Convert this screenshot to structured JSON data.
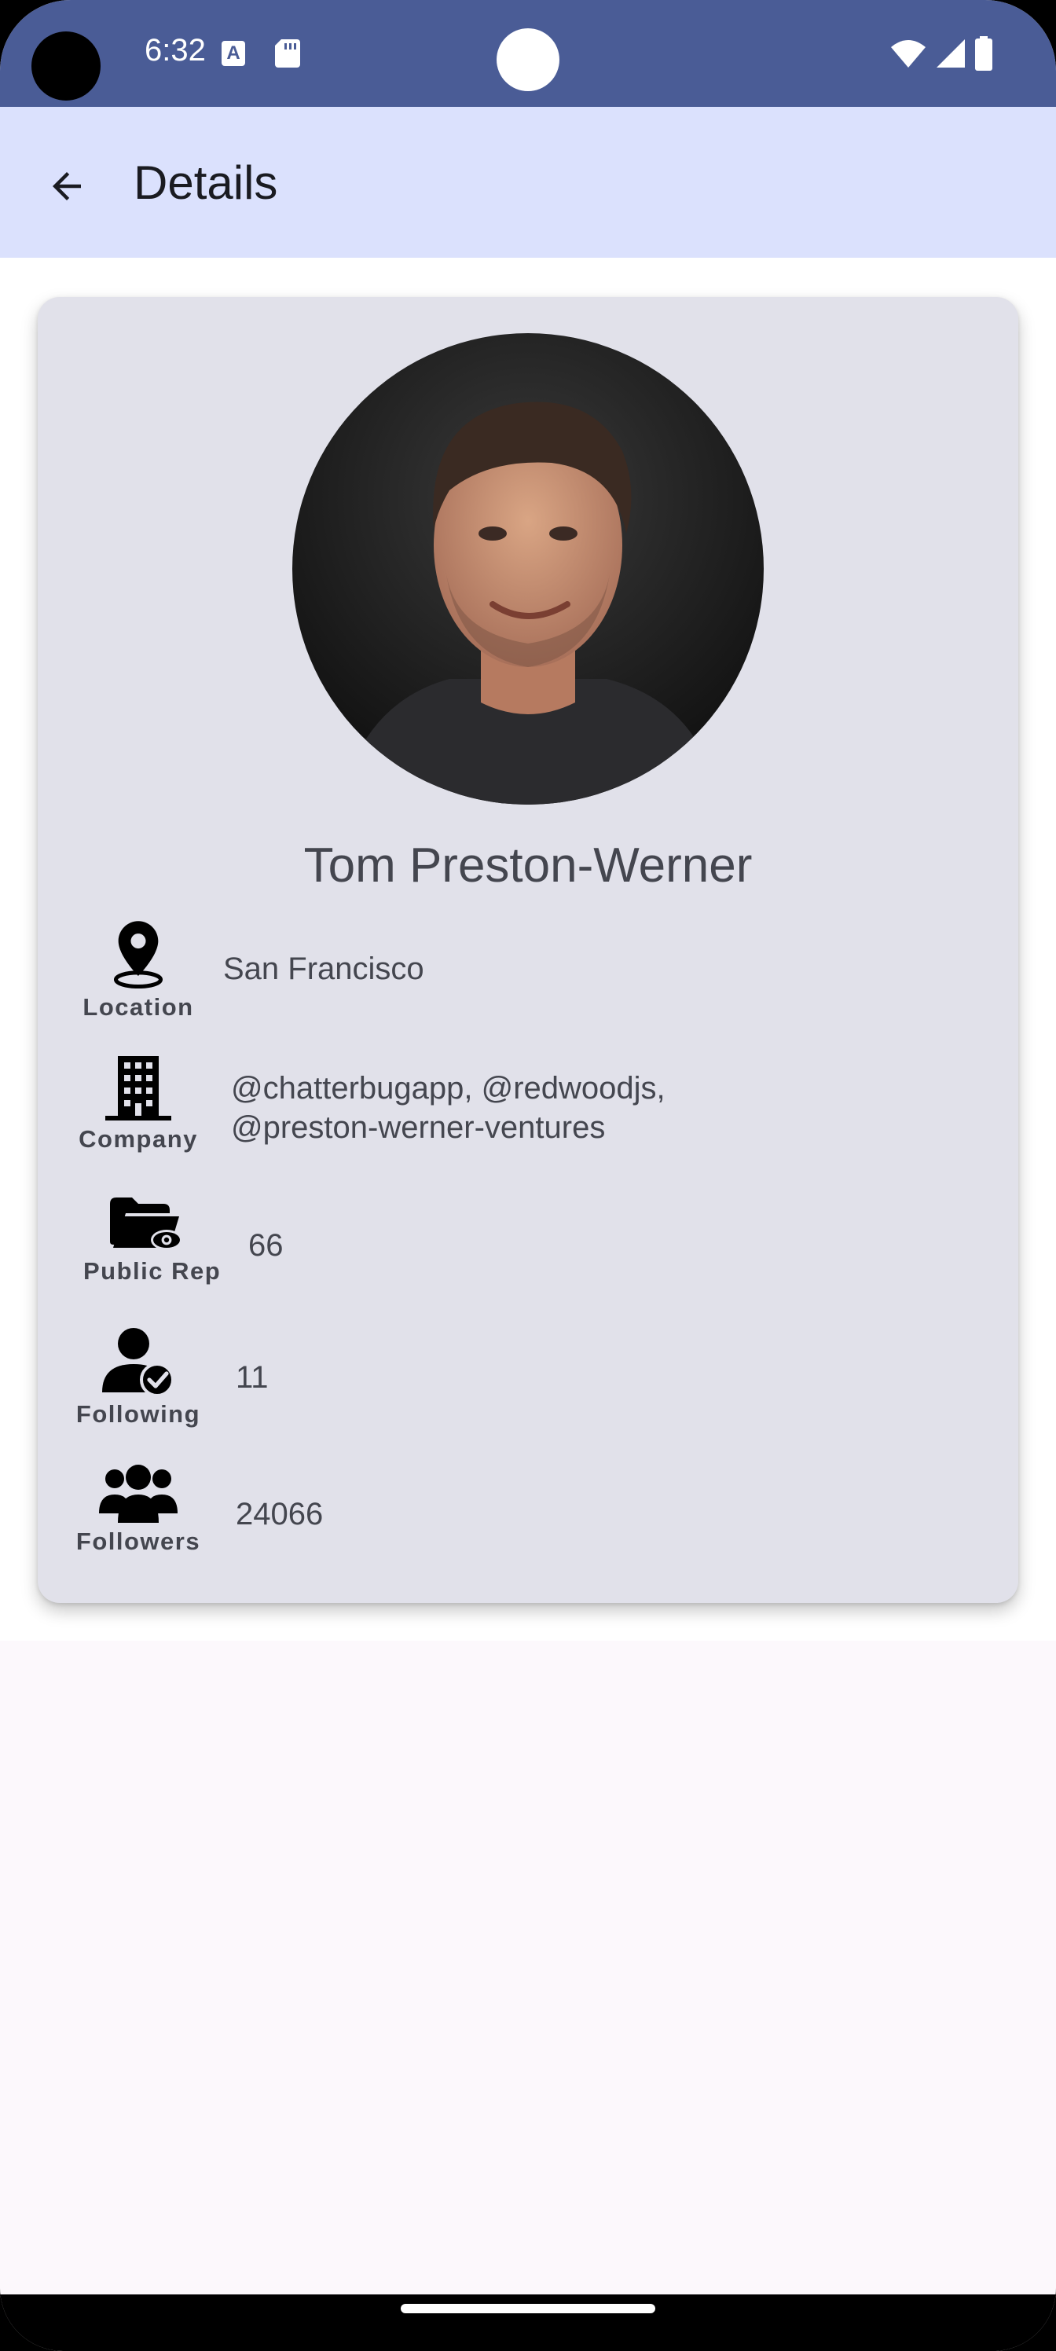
{
  "status_bar": {
    "time": "6:32",
    "icons": [
      "text-a-icon",
      "sd-card-icon",
      "wifi-icon",
      "signal-icon",
      "battery-icon"
    ]
  },
  "app_bar": {
    "back_icon": "arrow-back-icon",
    "title": "Details"
  },
  "profile": {
    "name": "Tom Preston-Werner",
    "rows": [
      {
        "icon": "location-pin-icon",
        "label": "Location",
        "value": "San Francisco"
      },
      {
        "icon": "company-building-icon",
        "label": "Company",
        "value_line1": "@chatterbugapp, @redwoodjs,",
        "value_line2": "@preston-werner-ventures"
      },
      {
        "icon": "folder-eye-icon",
        "label": "Public Rep",
        "value": "66"
      },
      {
        "icon": "person-check-icon",
        "label": "Following",
        "value": "11"
      },
      {
        "icon": "group-icon",
        "label": "Followers",
        "value": "24066"
      }
    ]
  },
  "colors": {
    "status_bar": "#4a5c96",
    "app_bar": "#dbe1fd",
    "card": "#e1e1ea",
    "text": "#44464f"
  }
}
